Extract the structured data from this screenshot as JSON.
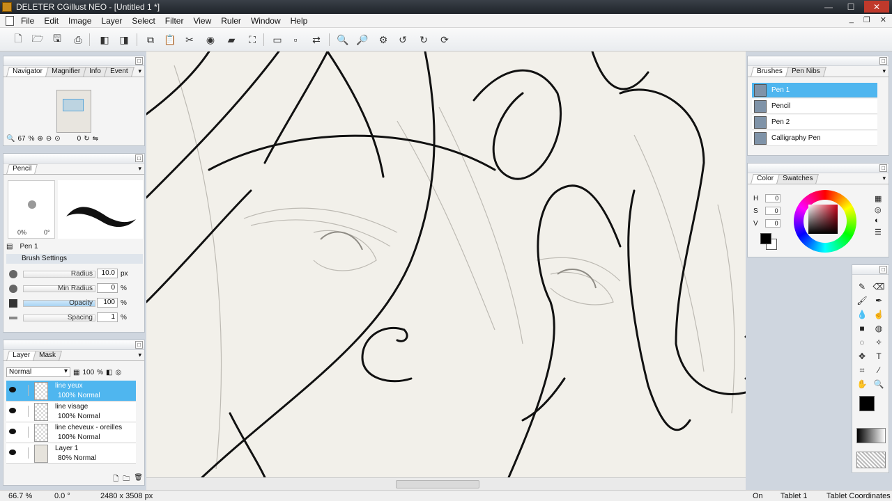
{
  "window": {
    "title": "DELETER CGillust NEO - [Untitled 1 *]"
  },
  "menu": [
    "File",
    "Edit",
    "Image",
    "Layer",
    "Select",
    "Filter",
    "View",
    "Ruler",
    "Window",
    "Help"
  ],
  "navigator": {
    "tabs": [
      "Navigator",
      "Magnifier",
      "Info",
      "Event"
    ],
    "zoom": "67",
    "zoom_unit": "%",
    "rotation": "0"
  },
  "tool_panel": {
    "tab": "Pencil",
    "opacity_pct": "0%",
    "angle": "0°",
    "tool_name": "Pen 1",
    "settings_title": "Brush Settings",
    "settings": [
      {
        "name": "Radius",
        "value": "10.0",
        "unit": "px"
      },
      {
        "name": "Min Radius",
        "value": "0",
        "unit": "%"
      },
      {
        "name": "Opacity",
        "value": "100",
        "unit": "%"
      },
      {
        "name": "Spacing",
        "value": "1",
        "unit": "%"
      }
    ]
  },
  "layers": {
    "tabs": [
      "Layer",
      "Mask"
    ],
    "blend_mode": "Normal",
    "opacity": "100",
    "items": [
      {
        "name": "line yeux",
        "mode": "100% Normal",
        "selected": true
      },
      {
        "name": "line visage",
        "mode": "100% Normal",
        "selected": false
      },
      {
        "name": "line cheveux - oreilles",
        "mode": "100% Normal",
        "selected": false
      },
      {
        "name": "Layer 1",
        "mode": "80% Normal",
        "selected": false
      }
    ]
  },
  "brushes": {
    "tabs": [
      "Brushes",
      "Pen Nibs"
    ],
    "items": [
      "Pen 1",
      "Pencil",
      "Pen 2",
      "Calligraphy Pen"
    ]
  },
  "color": {
    "tabs": [
      "Color",
      "Swatches"
    ],
    "h_label": "H",
    "s_label": "S",
    "v_label": "V",
    "h": "0",
    "s": "0",
    "v": "0",
    "foreground": "#000000",
    "background": "#ffffff"
  },
  "status": {
    "zoom": "66.7 %",
    "angle": "0.0 °",
    "size": "2480 x 3508 px",
    "pen_state": "On",
    "tablet": "Tablet 1",
    "coords": "Tablet Coordinates"
  },
  "colors": {
    "accent": "#4fb6ef",
    "canvas": "#f2f0ea"
  }
}
